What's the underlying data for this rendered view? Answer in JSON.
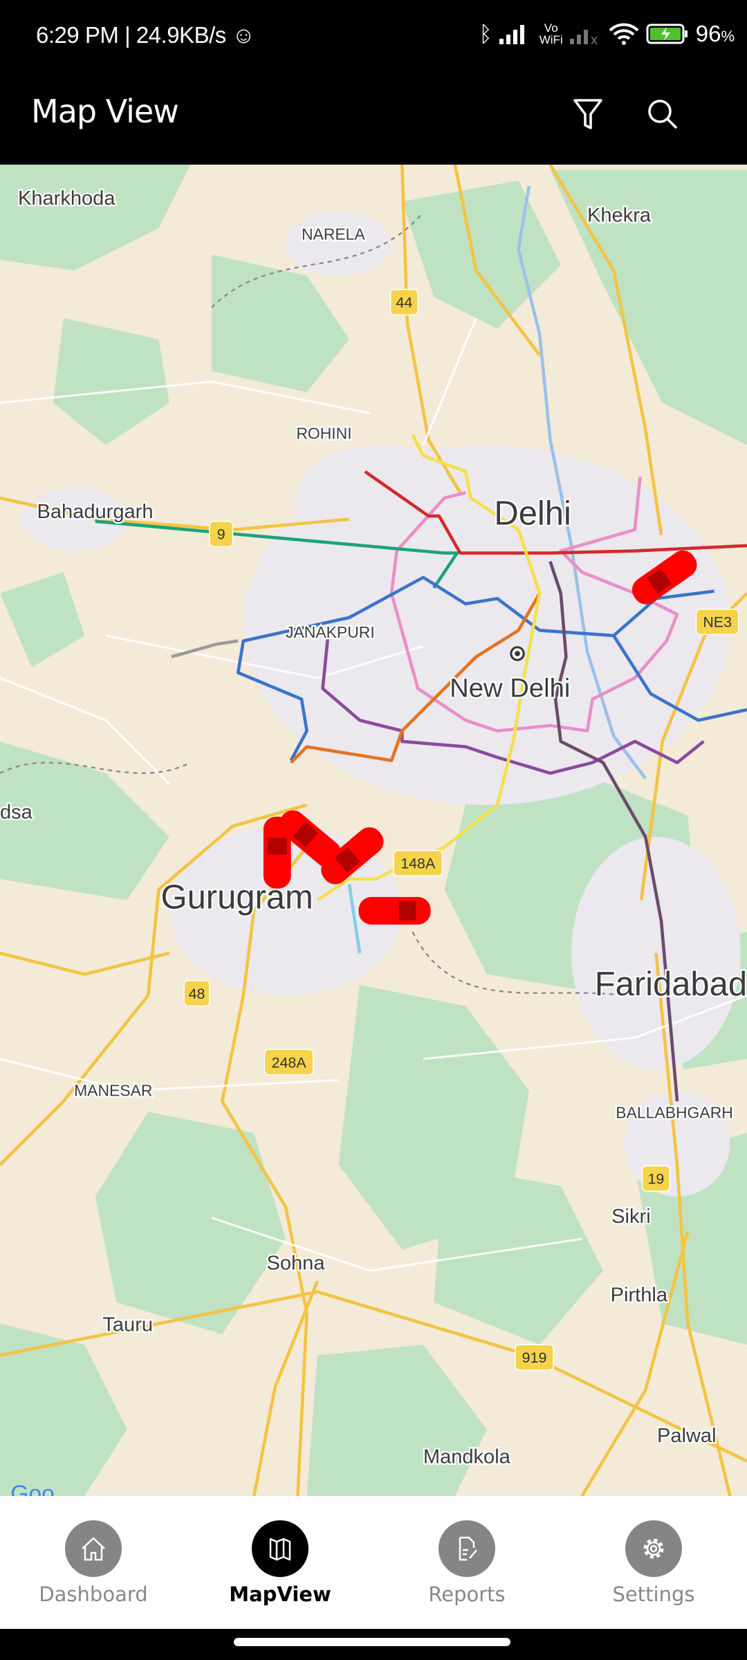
{
  "status_bar": {
    "time": "6:29 PM",
    "speed": "24.9KB/s",
    "battery": "96",
    "battery_unit": "%",
    "vowifi_top": "Vo",
    "vowifi_bottom": "WiFi"
  },
  "header": {
    "title": "Map View",
    "icons": [
      "filter-icon",
      "search-icon"
    ]
  },
  "map": {
    "labels": {
      "kharkhoda": "Kharkhoda",
      "narela": "NARELA",
      "khekra": "Khekra",
      "rohini": "ROHINI",
      "bahadurgarh": "Bahadurgarh",
      "delhi": "Delhi",
      "janakpuri": "JANAKPURI",
      "new_delhi": "New Delhi",
      "dsa": "dsa",
      "gurugram": "Gurugram",
      "faridabad": "Faridabad",
      "manesar": "MANESAR",
      "ballabhgarh": "BALLABHGARH",
      "sikri": "Sikri",
      "sohna": "Sohna",
      "pirthla": "Pirthla",
      "tauru": "Tauru",
      "palwal": "Palwal",
      "mandkola": "Mandkola"
    },
    "road_shields": {
      "nh44": "44",
      "nh9": "9",
      "ne3": "NE3",
      "nh148a": "148A",
      "nh48": "48",
      "nh248a": "248A",
      "nh19": "19",
      "nh919": "919"
    },
    "vehicle_marker_color": "#ff0000",
    "vehicle_count_visible": 5,
    "metro_colors": {
      "green": "#1aa37a",
      "red": "#d42a2a",
      "blue": "#3a74c9",
      "pink": "#e98ec8",
      "purple": "#8a4a9e",
      "orange": "#e6721e",
      "yellow": "#f5e04a",
      "violet": "#6b4b6b"
    }
  },
  "bottom_nav": {
    "items": [
      {
        "label": "Dashboard",
        "icon": "home-icon",
        "active": false
      },
      {
        "label": "MapView",
        "icon": "map-icon",
        "active": true
      },
      {
        "label": "Reports",
        "icon": "report-icon",
        "active": false
      },
      {
        "label": "Settings",
        "icon": "gear-icon",
        "active": false
      }
    ]
  }
}
